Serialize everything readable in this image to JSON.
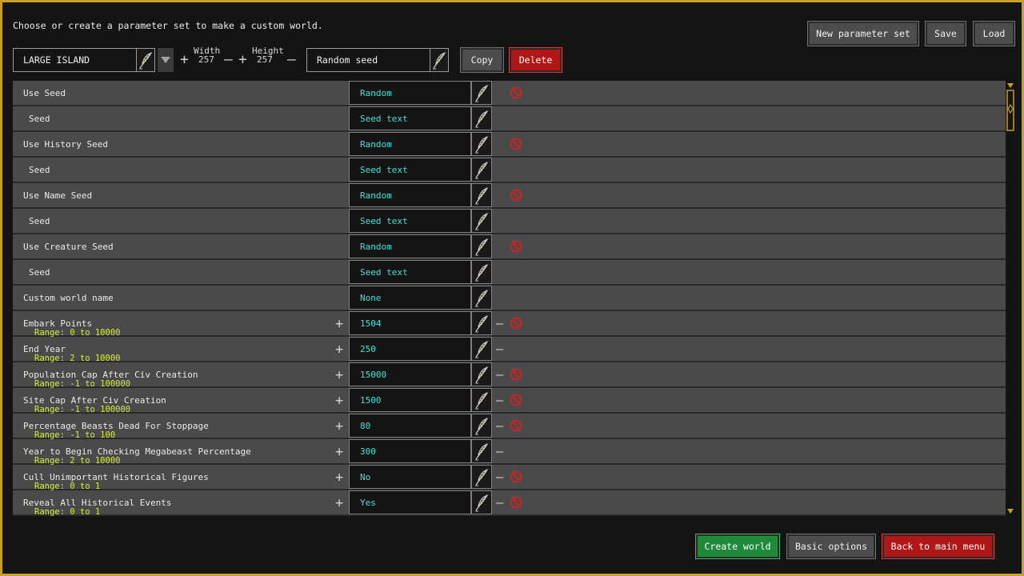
{
  "header": {
    "instruction": "Choose or create a parameter set to make a custom world.",
    "new_param_set": "New parameter set",
    "save": "Save",
    "load": "Load"
  },
  "params": {
    "set_name": "LARGE ISLAND",
    "width_label": "Width",
    "width_value": "257",
    "height_label": "Height",
    "height_value": "257",
    "seed_value": "Random seed",
    "copy": "Copy",
    "delete": "Delete"
  },
  "rows": [
    {
      "name": "Use Seed",
      "value": "Random",
      "sub": false,
      "range": "",
      "plus": false,
      "minus": false,
      "forbid": true
    },
    {
      "name": "Seed",
      "value": "Seed text",
      "sub": true,
      "range": "",
      "plus": false,
      "minus": false,
      "forbid": false
    },
    {
      "name": "Use History Seed",
      "value": "Random",
      "sub": false,
      "range": "",
      "plus": false,
      "minus": false,
      "forbid": true
    },
    {
      "name": "Seed",
      "value": "Seed text",
      "sub": true,
      "range": "",
      "plus": false,
      "minus": false,
      "forbid": false
    },
    {
      "name": "Use Name Seed",
      "value": "Random",
      "sub": false,
      "range": "",
      "plus": false,
      "minus": false,
      "forbid": true
    },
    {
      "name": "Seed",
      "value": "Seed text",
      "sub": true,
      "range": "",
      "plus": false,
      "minus": false,
      "forbid": false
    },
    {
      "name": "Use Creature Seed",
      "value": "Random",
      "sub": false,
      "range": "",
      "plus": false,
      "minus": false,
      "forbid": true
    },
    {
      "name": "Seed",
      "value": "Seed text",
      "sub": true,
      "range": "",
      "plus": false,
      "minus": false,
      "forbid": false
    },
    {
      "name": "Custom world name",
      "value": "None",
      "sub": false,
      "range": "",
      "plus": false,
      "minus": false,
      "forbid": false
    },
    {
      "name": "Embark Points",
      "value": "1504",
      "sub": false,
      "range": "Range: 0 to 10000",
      "plus": true,
      "minus": true,
      "forbid": true
    },
    {
      "name": "End Year",
      "value": "250",
      "sub": false,
      "range": "Range: 2 to 10000",
      "plus": true,
      "minus": true,
      "forbid": false
    },
    {
      "name": "Population Cap After Civ Creation",
      "value": "15000",
      "sub": false,
      "range": "Range: -1 to 100000",
      "plus": true,
      "minus": true,
      "forbid": true
    },
    {
      "name": "Site Cap After Civ Creation",
      "value": "1500",
      "sub": false,
      "range": "Range: -1 to 100000",
      "plus": true,
      "minus": true,
      "forbid": true
    },
    {
      "name": "Percentage Beasts Dead For Stoppage",
      "value": "80",
      "sub": false,
      "range": "Range: -1 to 100",
      "plus": true,
      "minus": true,
      "forbid": true
    },
    {
      "name": "Year to Begin Checking Megabeast Percentage",
      "value": "300",
      "sub": false,
      "range": "Range: 2 to 10000",
      "plus": true,
      "minus": true,
      "forbid": false
    },
    {
      "name": "Cull Unimportant Historical Figures",
      "value": "No",
      "sub": false,
      "range": "Range: 0 to 1",
      "plus": true,
      "minus": true,
      "forbid": true
    },
    {
      "name": "Reveal All Historical Events",
      "value": "Yes",
      "sub": false,
      "range": "Range: 0 to 1",
      "plus": true,
      "minus": true,
      "forbid": true
    }
  ],
  "footer": {
    "create": "Create world",
    "basic": "Basic options",
    "back": "Back to main menu"
  },
  "colors": {
    "accent_border": "#c8a028",
    "value_text": "#40e0d8",
    "range_text": "#d6e83c",
    "forbid": "#d42020"
  }
}
